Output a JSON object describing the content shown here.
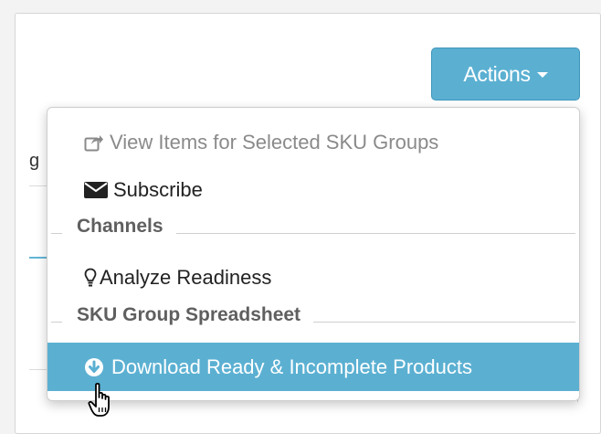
{
  "background": {
    "partial_label": "g"
  },
  "actions_button": {
    "label": "Actions"
  },
  "menu": {
    "items": [
      {
        "label": "View Items for Selected SKU Groups",
        "icon": "share-icon",
        "disabled": true
      },
      {
        "label": "Subscribe",
        "icon": "envelope-icon",
        "disabled": false
      }
    ],
    "sections": [
      {
        "header": "Channels",
        "items": [
          {
            "label": "Analyze Readiness",
            "icon": "lightbulb-icon"
          }
        ]
      },
      {
        "header": "SKU Group Spreadsheet",
        "items": [
          {
            "label": "Download Ready & Incomplete Products",
            "icon": "circle-download-icon",
            "highlighted": true
          }
        ]
      }
    ]
  },
  "colors": {
    "accent": "#5bb0d2",
    "disabled_text": "#8a8a8a",
    "header_text": "#5f5f5f"
  }
}
